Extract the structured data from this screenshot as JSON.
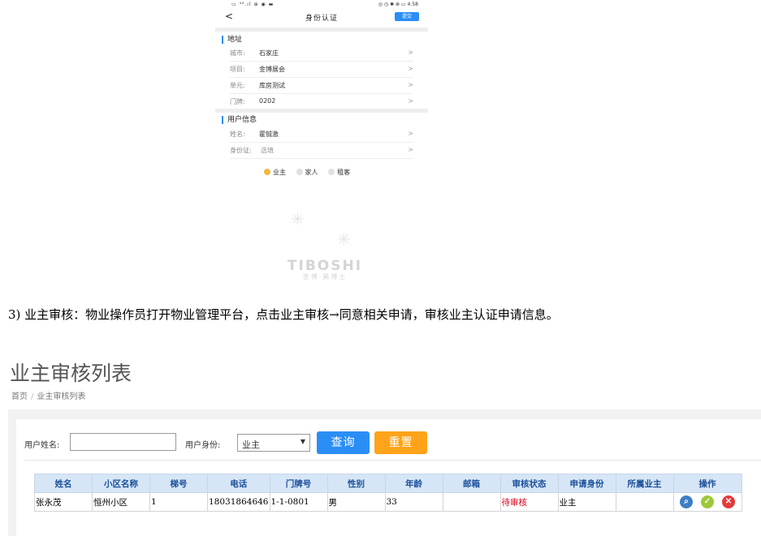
{
  "phone": {
    "status_left": "▭ ⁴⁶.ıl ⊕ ◉ ▬",
    "status_right": "◎ ◷ ✱ ⊗ ▭ 4:58",
    "back": "<",
    "title": "身份认证",
    "submit": "提交",
    "address_section": "地址",
    "address_rows": [
      {
        "label": "城市:",
        "value": "石家庄",
        "chevron": ">"
      },
      {
        "label": "项目:",
        "value": "金博展会",
        "chevron": ">"
      },
      {
        "label": "单元:",
        "value": "库房测试",
        "chevron": ">"
      },
      {
        "label": "门牌:",
        "value": "0202",
        "chevron": ">"
      }
    ],
    "user_section": "用户信息",
    "user_rows": [
      {
        "label": "姓名:",
        "value": "霍铖激",
        "chevron": ">"
      },
      {
        "label": "身份证:",
        "value": "选填",
        "chevron": ">"
      }
    ],
    "roles": [
      "业主",
      "家人",
      "租客"
    ],
    "role_selected": "业主",
    "logo_main": "TIBOSHI",
    "logo_sub": "金博·豨博士"
  },
  "doc": {
    "paragraph": "3)   业主审核：物业操作员打开物业管理平台，点击业主审核→同意相关申请，审核业主认证申请信息。"
  },
  "admin": {
    "title": "业主审核列表",
    "breadcrumb": {
      "home": "首页",
      "sep": "/",
      "current": "业主审核列表"
    },
    "search": {
      "name_label": "用户姓名:",
      "name_value": "",
      "role_label": "用户身份:",
      "role_value": "业主",
      "query_button": "查询",
      "reset_button": "重置"
    },
    "table": {
      "columns": [
        "姓名",
        "小区名称",
        "梯号",
        "电话",
        "门牌号",
        "性别",
        "年龄",
        "邮箱",
        "审核状态",
        "申请身份",
        "所属业主",
        "操作"
      ],
      "rows": [
        [
          "张永茂",
          "恒州小区",
          "1",
          "18031864646",
          "1-1-0801",
          "男",
          "33",
          "",
          "待审核",
          "业主",
          ""
        ]
      ]
    },
    "colors": {
      "accent_blue": "#2b8ef5",
      "accent_orange": "#ffa31a",
      "status_red": "#e0001a",
      "header_bg": "#d6e6f7"
    },
    "icons": [
      "view-icon",
      "approve-icon",
      "reject-icon"
    ]
  }
}
